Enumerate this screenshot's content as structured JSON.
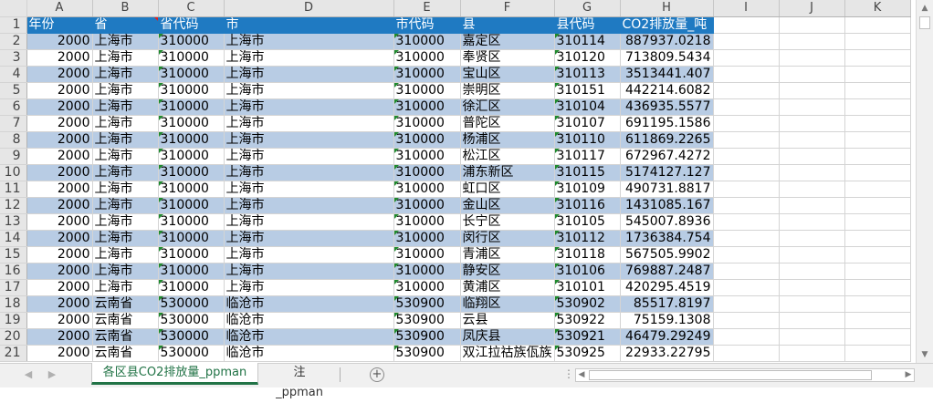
{
  "columns": [
    "A",
    "B",
    "C",
    "D",
    "E",
    "F",
    "G",
    "H",
    "I",
    "J",
    "K"
  ],
  "header_row": {
    "number": "1",
    "cells": [
      "年份",
      "省",
      "省代码",
      "市",
      "市代码",
      "县",
      "县代码",
      "CO2排放量_吨"
    ]
  },
  "rows": [
    {
      "n": "2",
      "year": "2000",
      "prov": "上海市",
      "prov_code": "310000",
      "city": "上海市",
      "city_code": "310000",
      "county": "嘉定区",
      "county_code": "310114",
      "co2": "887937.0218"
    },
    {
      "n": "3",
      "year": "2000",
      "prov": "上海市",
      "prov_code": "310000",
      "city": "上海市",
      "city_code": "310000",
      "county": "奉贤区",
      "county_code": "310120",
      "co2": "713809.5434"
    },
    {
      "n": "4",
      "year": "2000",
      "prov": "上海市",
      "prov_code": "310000",
      "city": "上海市",
      "city_code": "310000",
      "county": "宝山区",
      "county_code": "310113",
      "co2": "3513441.407"
    },
    {
      "n": "5",
      "year": "2000",
      "prov": "上海市",
      "prov_code": "310000",
      "city": "上海市",
      "city_code": "310000",
      "county": "崇明区",
      "county_code": "310151",
      "co2": "442214.6082"
    },
    {
      "n": "6",
      "year": "2000",
      "prov": "上海市",
      "prov_code": "310000",
      "city": "上海市",
      "city_code": "310000",
      "county": "徐汇区",
      "county_code": "310104",
      "co2": "436935.5577"
    },
    {
      "n": "7",
      "year": "2000",
      "prov": "上海市",
      "prov_code": "310000",
      "city": "上海市",
      "city_code": "310000",
      "county": "普陀区",
      "county_code": "310107",
      "co2": "691195.1586"
    },
    {
      "n": "8",
      "year": "2000",
      "prov": "上海市",
      "prov_code": "310000",
      "city": "上海市",
      "city_code": "310000",
      "county": "杨浦区",
      "county_code": "310110",
      "co2": "611869.2265"
    },
    {
      "n": "9",
      "year": "2000",
      "prov": "上海市",
      "prov_code": "310000",
      "city": "上海市",
      "city_code": "310000",
      "county": "松江区",
      "county_code": "310117",
      "co2": "672967.4272"
    },
    {
      "n": "10",
      "year": "2000",
      "prov": "上海市",
      "prov_code": "310000",
      "city": "上海市",
      "city_code": "310000",
      "county": "浦东新区",
      "county_code": "310115",
      "co2": "5174127.127"
    },
    {
      "n": "11",
      "year": "2000",
      "prov": "上海市",
      "prov_code": "310000",
      "city": "上海市",
      "city_code": "310000",
      "county": "虹口区",
      "county_code": "310109",
      "co2": "490731.8817"
    },
    {
      "n": "12",
      "year": "2000",
      "prov": "上海市",
      "prov_code": "310000",
      "city": "上海市",
      "city_code": "310000",
      "county": "金山区",
      "county_code": "310116",
      "co2": "1431085.167"
    },
    {
      "n": "13",
      "year": "2000",
      "prov": "上海市",
      "prov_code": "310000",
      "city": "上海市",
      "city_code": "310000",
      "county": "长宁区",
      "county_code": "310105",
      "co2": "545007.8936"
    },
    {
      "n": "14",
      "year": "2000",
      "prov": "上海市",
      "prov_code": "310000",
      "city": "上海市",
      "city_code": "310000",
      "county": "闵行区",
      "county_code": "310112",
      "co2": "1736384.754"
    },
    {
      "n": "15",
      "year": "2000",
      "prov": "上海市",
      "prov_code": "310000",
      "city": "上海市",
      "city_code": "310000",
      "county": "青浦区",
      "county_code": "310118",
      "co2": "567505.9902"
    },
    {
      "n": "16",
      "year": "2000",
      "prov": "上海市",
      "prov_code": "310000",
      "city": "上海市",
      "city_code": "310000",
      "county": "静安区",
      "county_code": "310106",
      "co2": "769887.2487"
    },
    {
      "n": "17",
      "year": "2000",
      "prov": "上海市",
      "prov_code": "310000",
      "city": "上海市",
      "city_code": "310000",
      "county": "黄浦区",
      "county_code": "310101",
      "co2": "420295.4519"
    },
    {
      "n": "18",
      "year": "2000",
      "prov": "云南省",
      "prov_code": "530000",
      "city": "临沧市",
      "city_code": "530900",
      "county": "临翔区",
      "county_code": "530902",
      "co2": "85517.8197"
    },
    {
      "n": "19",
      "year": "2000",
      "prov": "云南省",
      "prov_code": "530000",
      "city": "临沧市",
      "city_code": "530900",
      "county": "云县",
      "county_code": "530922",
      "co2": "75159.1308"
    },
    {
      "n": "20",
      "year": "2000",
      "prov": "云南省",
      "prov_code": "530000",
      "city": "临沧市",
      "city_code": "530900",
      "county": "凤庆县",
      "county_code": "530921",
      "co2": "46479.29249"
    },
    {
      "n": "21",
      "year": "2000",
      "prov": "云南省",
      "prov_code": "530000",
      "city": "临沧市",
      "city_code": "530900",
      "county": "双江拉祜族佤族",
      "county_code": "530925",
      "co2": "22933.22795"
    }
  ],
  "sheet_tabs": [
    "各区县CO2排放量_ppman",
    "注_ppman"
  ],
  "active_tab": "各区县CO2排放量_ppman",
  "add_sheet_symbol": "+",
  "icons": {
    "tab_prev": "◀",
    "tab_next": "▶",
    "scroll_up": "▲",
    "scroll_down": "▼",
    "scroll_left": "◀",
    "scroll_right": "▶",
    "options": "⋮"
  },
  "colors": {
    "header_fill": "#1f7ac2",
    "band_fill": "#b8cce4",
    "active_tab_accent": "#217346"
  }
}
